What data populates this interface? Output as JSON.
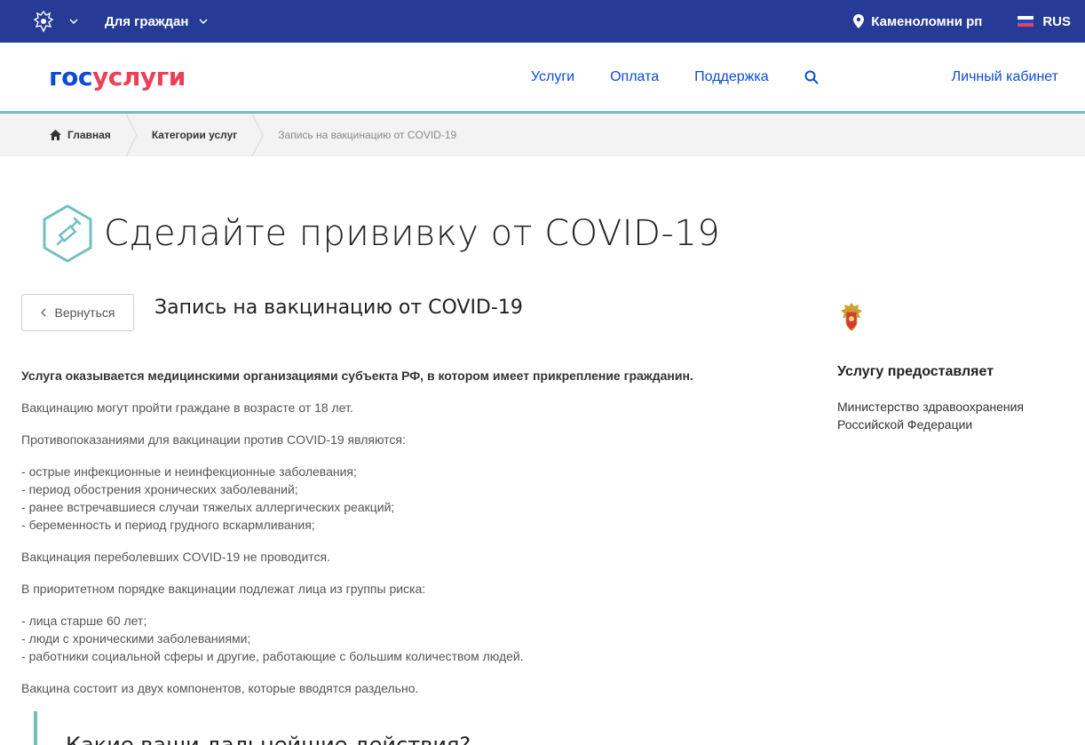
{
  "topbar": {
    "for_citizens": "Для граждан",
    "location": "Каменоломни рп",
    "language": "RUS",
    "bg_color": "#253b95"
  },
  "header": {
    "logo_part1": "гос",
    "logo_part2": "услуги",
    "nav": [
      "Услуги",
      "Оплата",
      "Поддержка"
    ],
    "cabinet": "Личный кабинет",
    "accent": "#0d4cd3"
  },
  "breadcrumb": {
    "items": [
      "Главная",
      "Категории услуг",
      "Запись на вакцинацию от COVID-19"
    ]
  },
  "page": {
    "title": "Сделайте прививку от COVID-19",
    "icon": "syringe-icon"
  },
  "service": {
    "back_label": "Вернуться",
    "title": "Запись на вакцинацию от COVID-19",
    "paragraphs": {
      "p1": "Услуга оказывается медицинскими организациями субъекта РФ, в котором имеет прикрепление гражданин.",
      "p2": "Вакцинацию могут пройти граждане в возрасте от 18 лет.",
      "p3": "Противопоказаниями для вакцинации против COVID-19 являются:",
      "p4": "Вакцинация переболевших COVID-19 не проводится.",
      "p5": "В приоритетном порядке вакцинации подлежат лица из группы риска:",
      "p6": "Вакцина состоит из двух компонентов, которые вводятся раздельно."
    },
    "contraindications": [
      "острые инфекционные и неинфекционные заболевания;",
      "период обострения хронических заболеваний;",
      "ранее встречавшиеся случаи тяжелых аллергических реакций;",
      "беременность и период грудного вскармливания;"
    ],
    "risk_groups": [
      "лица старше 60 лет;",
      "люди с хроническими заболеваниями;",
      "работники социальной сферы и другие, работающие с большим количеством людей."
    ],
    "next_steps_title": "Какие ваши дальнейшие действия?"
  },
  "sidebar": {
    "provider_label": "Услугу предоставляет",
    "provider_name_line1": "Министерство здравоохранения",
    "provider_name_line2": "Российской Федерации"
  }
}
